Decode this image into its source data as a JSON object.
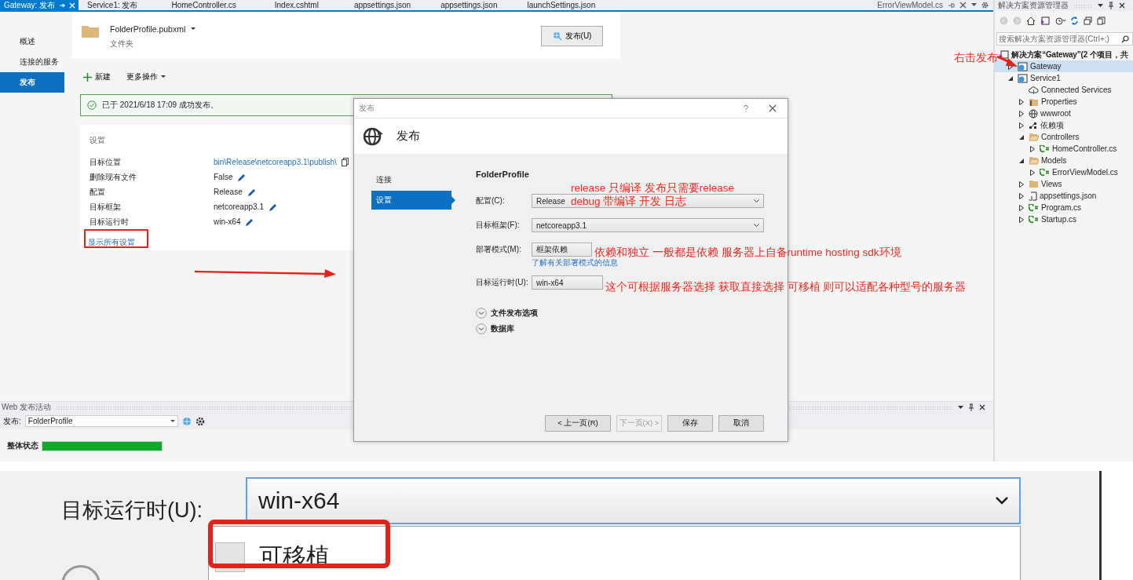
{
  "editor_tabs": [
    {
      "label": "Gateway: 发布",
      "selected": true
    },
    {
      "label": "Service1: 发布",
      "selected": false
    },
    {
      "label": "HomeController.cs",
      "selected": false
    },
    {
      "label": "Index.cshtml",
      "selected": false
    },
    {
      "label": "appsettings.json",
      "selected": false
    },
    {
      "label": "appsettings.json",
      "selected": false
    },
    {
      "label": "launchSettings.json",
      "selected": false
    }
  ],
  "overflow_tab": "ErrorViewModel.cs",
  "publish_page": {
    "nav": [
      {
        "label": "概述",
        "selected": false
      },
      {
        "label": "连接的服务",
        "selected": false
      },
      {
        "label": "发布",
        "selected": true
      }
    ],
    "profile": {
      "name": "FolderProfile.pubxml",
      "type": "文件夹"
    },
    "publish_button": "发布(U)",
    "toolbar": {
      "new": "新建",
      "more": "更多操作"
    },
    "success_message": "已于 2021/6/18 17:09 成功发布。",
    "settings": {
      "title": "设置",
      "rows": [
        {
          "label": "目标位置",
          "value": "bin\\Release\\netcoreapp3.1\\publish\\",
          "kind": "path"
        },
        {
          "label": "删除现有文件",
          "value": "False",
          "kind": "editable"
        },
        {
          "label": "配置",
          "value": "Release",
          "kind": "editable"
        },
        {
          "label": "目标框架",
          "value": "netcoreapp3.1",
          "kind": "editable"
        },
        {
          "label": "目标运行时",
          "value": "win-x64",
          "kind": "editable"
        }
      ]
    },
    "show_all_link": "显示所有设置"
  },
  "activity_panel": {
    "title": "Web 发布活动",
    "publish_label": "发布:",
    "profile": "FolderProfile",
    "status_label": "整体状态",
    "status": {
      "level": 1
    }
  },
  "dialog": {
    "title": "发布",
    "heading": "发布",
    "nav": [
      {
        "label": "连接",
        "selected": false
      },
      {
        "label": "设置",
        "selected": true
      }
    ],
    "profile": "FolderProfile",
    "fields": [
      {
        "label": "配置(C):",
        "value": "Release",
        "kind": "dropdown"
      },
      {
        "label": "目标框架(F):",
        "value": "netcoreapp3.1",
        "kind": "dropdown"
      },
      {
        "label": "部署模式(M):",
        "value": "框架依赖",
        "kind": "box"
      },
      {
        "label": "目标运行时(U):",
        "value": "win-x64",
        "kind": "box"
      }
    ],
    "deploy_link": "了解有关部署模式的信息",
    "sections": [
      {
        "label": "文件发布选项",
        "expanded": false
      },
      {
        "label": "数据库",
        "expanded": false
      }
    ],
    "buttons": [
      {
        "label": "< 上一页(R)",
        "disabled": false
      },
      {
        "label": "下一页(X) >",
        "disabled": true
      },
      {
        "label": "保存",
        "disabled": false
      },
      {
        "label": "取消",
        "disabled": false
      }
    ]
  },
  "solution_explorer": {
    "title": "解决方案资源管理器",
    "search_placeholder": "搜索解决方案资源管理器(Ctrl+;)",
    "tree": [
      {
        "label": "解决方案“Gateway”(2 个项目，共",
        "kind": "solution",
        "selected": false,
        "children": [
          {
            "label": "Gateway",
            "kind": "project",
            "expanded": false,
            "selected": true
          },
          {
            "label": "Service1",
            "kind": "project",
            "expanded": true,
            "selected": false,
            "children": [
              {
                "label": "Connected Services",
                "kind": "connected",
                "selected": false
              },
              {
                "label": "Properties",
                "kind": "properties",
                "expanded": false,
                "selected": false
              },
              {
                "label": "wwwroot",
                "kind": "globe",
                "expanded": false,
                "selected": false
              },
              {
                "label": "依赖项",
                "kind": "dependencies",
                "expanded": false,
                "selected": false
              },
              {
                "label": "Controllers",
                "kind": "folder",
                "expanded": true,
                "selected": false,
                "children": [
                  {
                    "label": "HomeController.cs",
                    "kind": "csharp",
                    "expanded": false,
                    "selected": false
                  }
                ]
              },
              {
                "label": "Models",
                "kind": "folder",
                "expanded": true,
                "selected": false,
                "children": [
                  {
                    "label": "ErrorViewModel.cs",
                    "kind": "csharp",
                    "expanded": false,
                    "selected": false
                  }
                ]
              },
              {
                "label": "Views",
                "kind": "folder",
                "expanded": false,
                "selected": false
              },
              {
                "label": "appsettings.json",
                "kind": "json",
                "expanded": false,
                "selected": false
              },
              {
                "label": "Program.cs",
                "kind": "csharp",
                "expanded": false,
                "selected": false
              },
              {
                "label": "Startup.cs",
                "kind": "csharp",
                "expanded": false,
                "selected": false
              }
            ]
          }
        ]
      }
    ]
  },
  "annotations": [
    {
      "text": "release 只编译 发布只需要release"
    },
    {
      "text": "debug 带编译 开发 日志"
    },
    {
      "text": "依赖和独立 一般都是依赖 服务器上自备runtime hosting sdk环境"
    },
    {
      "text": "这个可根据服务器选择 获取直接选择 可移植 则可以适配各种型号的服务器"
    },
    {
      "text": "右击发布"
    }
  ],
  "zoom_inset": {
    "label": "目标运行时(U):",
    "value": "win-x64",
    "options": [
      {
        "label": "可移植"
      }
    ]
  }
}
